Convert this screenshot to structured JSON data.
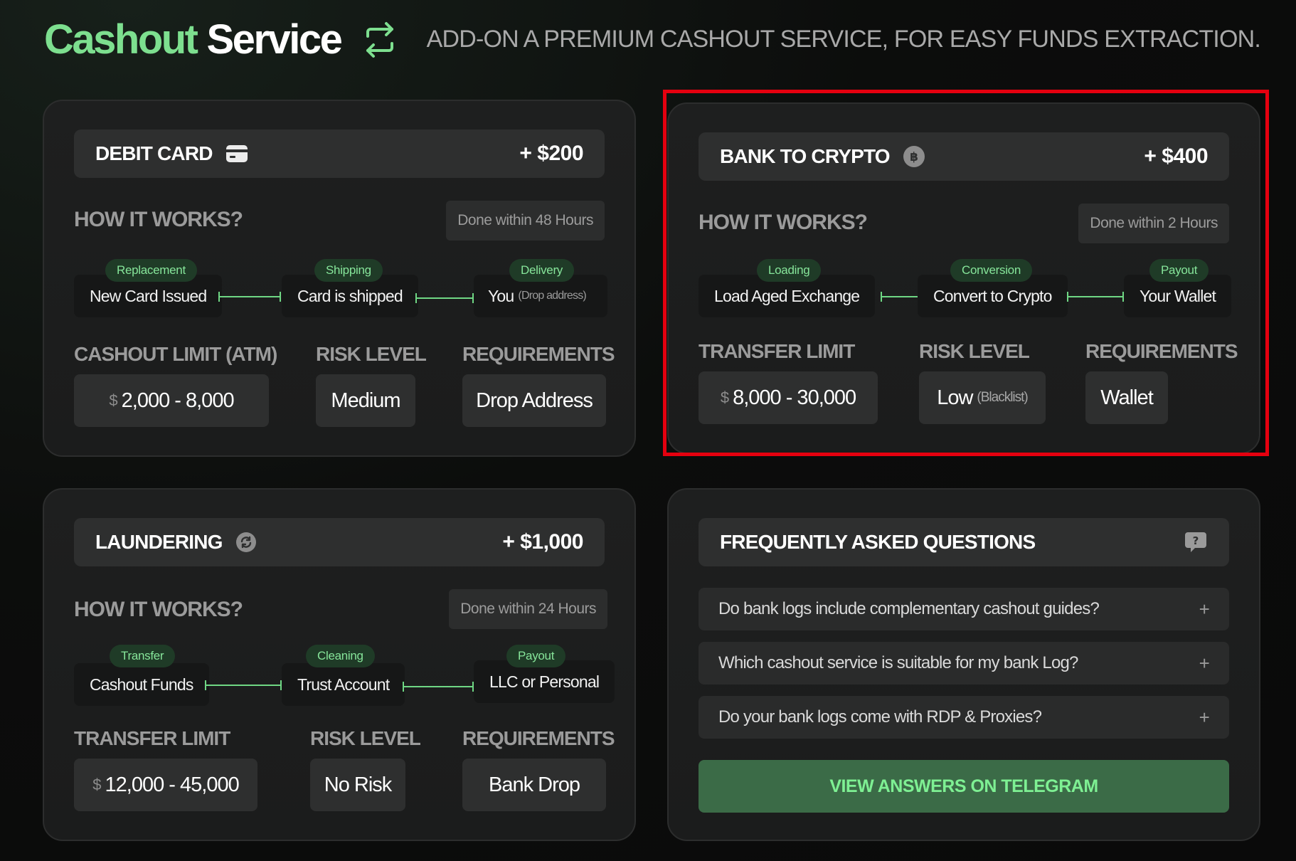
{
  "header": {
    "brand_main": "Cashout",
    "brand_sub": "Service",
    "brand_icon": "swap-arrows-icon",
    "tagline": "ADD-ON A PREMIUM CASHOUT SERVICE, FOR EASY FUNDS EXTRACTION."
  },
  "colors": {
    "accent_green": "#7ddf8f",
    "tag_bg": "#1f3b27",
    "highlight_red": "#e5000f",
    "button_bg": "#3b6b47"
  },
  "debit": {
    "title": "DEBIT CARD",
    "icon": "credit-card-icon",
    "price": "+ $200",
    "hiw": "HOW IT WORKS?",
    "done": "Done within 48 Hours",
    "steps": [
      {
        "tag": "Replacement",
        "label": "New Card Issued"
      },
      {
        "tag": "Shipping",
        "label": "Card is shipped"
      },
      {
        "tag": "Delivery",
        "label": "You",
        "small": "(Drop address)"
      }
    ],
    "limit_label": "CASHOUT LIMIT (ATM)",
    "risk_label": "RISK LEVEL",
    "req_label": "REQUIREMENTS",
    "limit_currency": "$",
    "limit_value": "2,000 - 8,000",
    "risk_value": "Medium",
    "req_value": "Drop Address"
  },
  "crypto": {
    "title": "BANK TO CRYPTO",
    "icon": "bitcoin-icon",
    "price": "+ $400",
    "hiw": "HOW IT WORKS?",
    "done": "Done within 2 Hours",
    "steps": [
      {
        "tag": "Loading",
        "label": "Load Aged Exchange"
      },
      {
        "tag": "Conversion",
        "label": "Convert to Crypto"
      },
      {
        "tag": "Payout",
        "label": "Your Wallet"
      }
    ],
    "limit_label": "TRANSFER LIMIT",
    "risk_label": "RISK LEVEL",
    "req_label": "REQUIREMENTS",
    "limit_currency": "$",
    "limit_value": "8,000 - 30,000",
    "risk_value": "Low",
    "risk_small": "(Blacklist)",
    "req_value": "Wallet"
  },
  "laundering": {
    "title": "LAUNDERING",
    "icon": "refresh-icon",
    "price": "+ $1,000",
    "hiw": "HOW IT WORKS?",
    "done": "Done within 24 Hours",
    "steps": [
      {
        "tag": "Transfer",
        "label": "Cashout Funds"
      },
      {
        "tag": "Cleaning",
        "label": "Trust Account"
      },
      {
        "tag": "Payout",
        "label": "LLC or Personal"
      }
    ],
    "limit_label": "TRANSFER LIMIT",
    "risk_label": "RISK LEVEL",
    "req_label": "REQUIREMENTS",
    "limit_currency": "$",
    "limit_value": "12,000 - 45,000",
    "risk_value": "No Risk",
    "req_value": "Bank Drop"
  },
  "faq": {
    "title": "FREQUENTLY ASKED QUESTIONS",
    "icon": "question-chat-icon",
    "items": [
      {
        "q": "Do bank logs include complementary cashout guides?",
        "icon": "plus-icon"
      },
      {
        "q": "Which cashout service is suitable for my bank Log?",
        "icon": "plus-icon"
      },
      {
        "q": "Do your bank logs come with RDP & Proxies?",
        "icon": "plus-icon"
      }
    ],
    "plus": "+",
    "button": "VIEW ANSWERS ON TELEGRAM"
  }
}
